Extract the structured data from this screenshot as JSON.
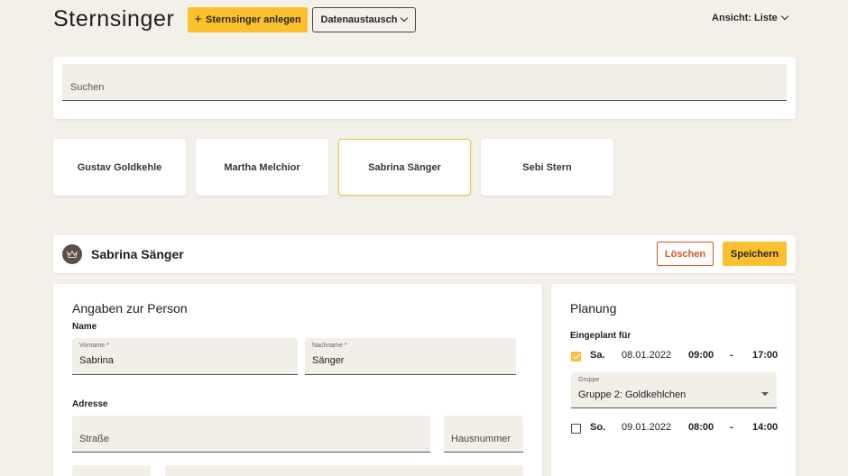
{
  "header": {
    "title": "Sternsinger",
    "add_button": "Sternsinger anlegen",
    "exchange_button": "Datenaustausch",
    "view_toggle": "Ansicht: Liste"
  },
  "search": {
    "placeholder": "Suchen"
  },
  "people": [
    {
      "name": "Gustav Goldkehle",
      "selected": false
    },
    {
      "name": "Martha Melchior",
      "selected": false
    },
    {
      "name": "Sabrina Sänger",
      "selected": true
    },
    {
      "name": "Sebi Stern",
      "selected": false
    }
  ],
  "detail": {
    "name": "Sabrina Sänger",
    "delete_button": "Löschen",
    "save_button": "Speichern"
  },
  "person_section": {
    "title": "Angaben zur Person",
    "name_heading": "Name",
    "firstname_label": "Vorname *",
    "firstname_value": "Sabrina",
    "lastname_label": "Nachname *",
    "lastname_value": "Sänger",
    "address_heading": "Adresse",
    "street_placeholder": "Straße",
    "house_number_placeholder": "Hausnummer"
  },
  "planning": {
    "title": "Planung",
    "scheduled_heading": "Eingeplant für",
    "group_label": "Gruppe",
    "slots": [
      {
        "day": "Sa.",
        "date": "08.01.2022",
        "start": "09:00",
        "sep": "-",
        "end": "17:00",
        "checked": true,
        "group": "Gruppe 2: Goldkehlchen"
      },
      {
        "day": "So.",
        "date": "09.01.2022",
        "start": "08:00",
        "sep": "-",
        "end": "14:00",
        "checked": false
      }
    ]
  },
  "colors": {
    "background": "#f2f0e9",
    "accent": "#fbc02d",
    "danger": "#d9532b",
    "field_bg": "#f1efe7"
  }
}
